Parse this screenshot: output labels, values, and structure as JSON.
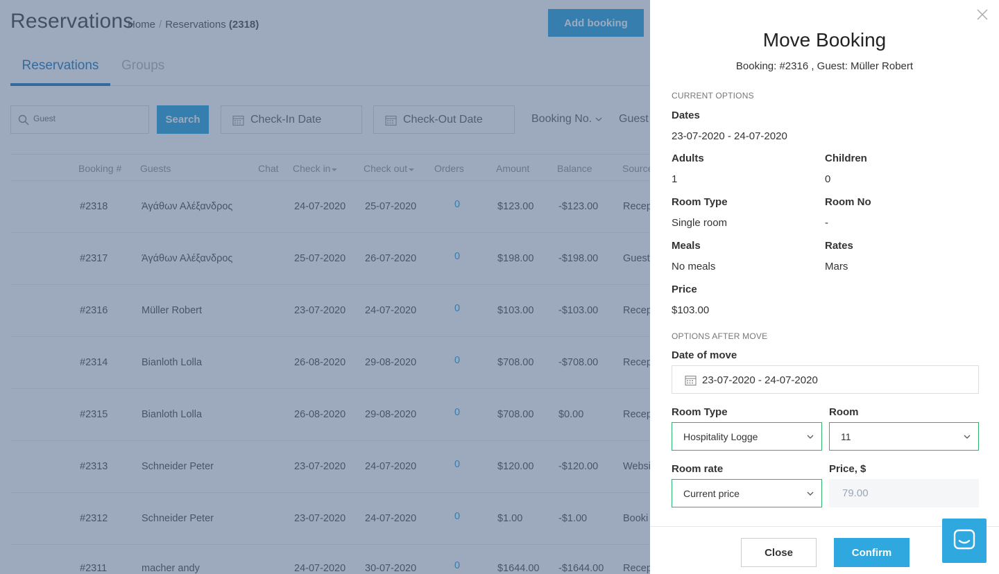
{
  "header": {
    "title": "Reservations",
    "breadcrumb_home": "Home",
    "breadcrumb_sep": "/",
    "breadcrumb_current": "Reservations",
    "breadcrumb_count": "(2318)",
    "add_booking_label": "Add booking"
  },
  "tabs": [
    {
      "label": "Reservations",
      "active": true
    },
    {
      "label": "Groups",
      "active": false
    }
  ],
  "filters": {
    "search_placeholder": "Guest",
    "search_label": "Search",
    "checkin_label": "Check-In Date",
    "checkout_label": "Check-Out Date",
    "booking_no_label": "Booking No.",
    "guest_label": "Guest"
  },
  "table": {
    "columns": {
      "booking": "Booking #",
      "guests": "Guests",
      "chat": "Chat",
      "checkin": "Check in",
      "checkout": "Check out",
      "orders": "Orders",
      "amount": "Amount",
      "balance": "Balance",
      "source": "Source"
    },
    "rows": [
      {
        "booking": "#2318",
        "guest": "Άγάθων Αλέξανδρος",
        "checkin": "24-07-2020",
        "checkout": "25-07-2020",
        "orders": "0",
        "amount": "$123.00",
        "balance": "-$123.00",
        "source": "Recep"
      },
      {
        "booking": "#2317",
        "guest": "Άγάθων Αλέξανδρος",
        "checkin": "25-07-2020",
        "checkout": "26-07-2020",
        "orders": "0",
        "amount": "$198.00",
        "balance": "-$198.00",
        "source": "Guest"
      },
      {
        "booking": "#2316",
        "guest": "Müller Robert",
        "checkin": "23-07-2020",
        "checkout": "24-07-2020",
        "orders": "0",
        "amount": "$103.00",
        "balance": "-$103.00",
        "source": "Recep"
      },
      {
        "booking": "#2314",
        "guest": "Bianloth Lolla",
        "checkin": "26-08-2020",
        "checkout": "29-08-2020",
        "orders": "0",
        "amount": "$708.00",
        "balance": "-$708.00",
        "source": "Recep"
      },
      {
        "booking": "#2315",
        "guest": "Bianloth Lolla",
        "checkin": "26-08-2020",
        "checkout": "29-08-2020",
        "orders": "0",
        "amount": "$708.00",
        "balance": "$0.00",
        "source": "Recep"
      },
      {
        "booking": "#2313",
        "guest": "Schneider Peter",
        "checkin": "23-07-2020",
        "checkout": "24-07-2020",
        "orders": "0",
        "amount": "$120.00",
        "balance": "-$120.00",
        "source": "Websi"
      },
      {
        "booking": "#2312",
        "guest": "Schneider Peter",
        "checkin": "23-07-2020",
        "checkout": "24-07-2020",
        "orders": "0",
        "amount": "$1.00",
        "balance": "-$1.00",
        "source": "Booki"
      },
      {
        "booking": "#2311",
        "guest": "macher andy",
        "checkin": "24-07-2020",
        "checkout": "30-07-2020",
        "orders": "0",
        "amount": "$1644.00",
        "balance": "-$1644.00",
        "source": "Recep"
      }
    ]
  },
  "modal": {
    "title": "Move Booking",
    "subtitle": "Booking: #2316 , Guest: Müller Robert",
    "current_section": "CURRENT OPTIONS",
    "dates_label": "Dates",
    "dates_value": "23-07-2020 - 24-07-2020",
    "adults_label": "Adults",
    "adults_value": "1",
    "children_label": "Children",
    "children_value": "0",
    "room_type_label": "Room Type",
    "room_type_value": "Single room",
    "room_no_label": "Room No",
    "room_no_value": "-",
    "meals_label": "Meals",
    "meals_value": "No meals",
    "rates_label": "Rates",
    "rates_value": "Mars",
    "price_label": "Price",
    "price_value": "$103.00",
    "after_section": "OPTIONS AFTER MOVE",
    "date_of_move_label": "Date of move",
    "date_of_move_value": "23-07-2020 - 24-07-2020",
    "new_room_type_label": "Room Type",
    "new_room_type_value": "Hospitality Logge",
    "room_label": "Room",
    "room_value": "11",
    "room_rate_label": "Room rate",
    "room_rate_value": "Current price",
    "new_price_label": "Price, $",
    "new_price_value": "79.00",
    "close_label": "Close",
    "confirm_label": "Confirm"
  },
  "colors": {
    "accent": "#2fa7df",
    "tab_active": "#2c7fb8",
    "overlay": "#3c567d",
    "select_border": "#2eb36a"
  },
  "icons": [
    "search-icon",
    "calendar-icon",
    "chevron-down-icon",
    "close-icon",
    "chat-icon"
  ]
}
